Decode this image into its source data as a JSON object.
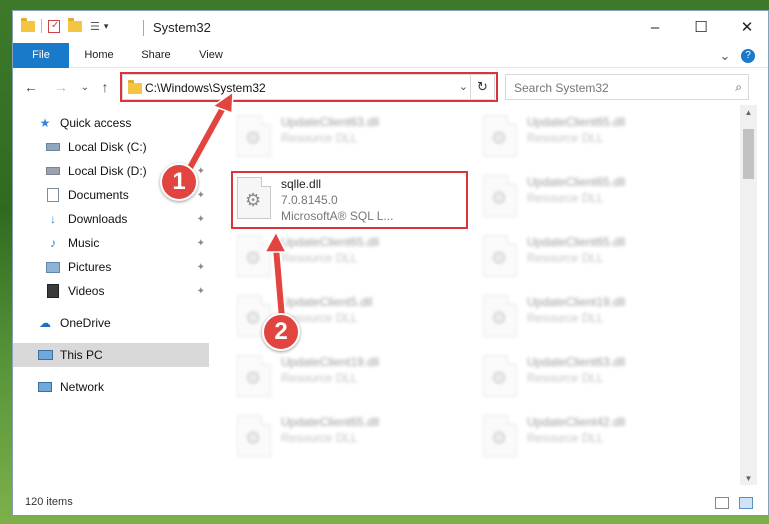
{
  "window": {
    "title": "System32",
    "controls": {
      "minimize": "–",
      "maximize": "☐",
      "close": "✕"
    }
  },
  "ribbon": {
    "tabs": [
      "File",
      "Home",
      "Share",
      "View"
    ],
    "expand": "⌄",
    "help": "?"
  },
  "address": {
    "path": "C:\\Windows\\System32",
    "search_placeholder": "Search System32"
  },
  "nav": {
    "back": "←",
    "forward": "→",
    "recent": "⌄",
    "up": "↑",
    "items": [
      {
        "label": "Quick access",
        "icon": "star-icon"
      },
      {
        "label": "Local Disk (C:)",
        "icon": "drive-icon"
      },
      {
        "label": "Local Disk (D:)",
        "icon": "drive-icon"
      },
      {
        "label": "Documents",
        "icon": "documents-icon"
      },
      {
        "label": "Downloads",
        "icon": "download-icon"
      },
      {
        "label": "Music",
        "icon": "music-icon"
      },
      {
        "label": "Pictures",
        "icon": "pictures-icon"
      },
      {
        "label": "Videos",
        "icon": "videos-icon"
      },
      {
        "label": "OneDrive",
        "icon": "cloud-icon"
      },
      {
        "label": "This PC",
        "icon": "computer-icon"
      },
      {
        "label": "Network",
        "icon": "network-icon"
      }
    ]
  },
  "files": {
    "target": {
      "name": "sqlle.dll",
      "version": "7.0.8145.0",
      "company": "MicrosoftA® SQL L..."
    },
    "background": [
      {
        "name": "UpdateClient63.dll",
        "type": "Resource DLL"
      },
      {
        "name": "UpdateClient65.dll",
        "type": "Resource DLL"
      },
      {
        "name": "UpdateClient65.dll",
        "type": "Resource DLL"
      },
      {
        "name": "UpdateClient65.dll",
        "type": "Resource DLL"
      },
      {
        "name": "UpdateClient65.dll",
        "type": "Resource DLL"
      },
      {
        "name": "UpdateClient5.dll",
        "type": "Resource DLL"
      },
      {
        "name": "UpdateClient19.dll",
        "type": "Resource DLL"
      },
      {
        "name": "UpdateClient19.dll",
        "type": "Resource DLL"
      },
      {
        "name": "UpdateClient63.dll",
        "type": "Resource DLL"
      },
      {
        "name": "UpdateClient65.dll",
        "type": "Resource DLL"
      },
      {
        "name": "UpdateClient42.dll",
        "type": "Resource DLL"
      }
    ]
  },
  "status": {
    "items_count": "120 items"
  },
  "callouts": [
    "1",
    "2"
  ],
  "colors": {
    "accent": "#1979ca",
    "highlight": "#d9353a",
    "callout": "#e2453f"
  }
}
